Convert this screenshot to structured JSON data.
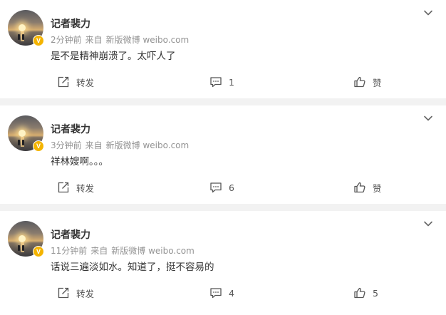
{
  "posts": [
    {
      "username": "记者裴力",
      "time": "2分钟前",
      "source_prefix": "来自",
      "source": "新版微博 weibo.com",
      "content": "是不是精神崩溃了。太吓人了",
      "repost_label": "转发",
      "comment_count": "1",
      "like_label": "赞"
    },
    {
      "username": "记者裴力",
      "time": "3分钟前",
      "source_prefix": "来自",
      "source": "新版微博 weibo.com",
      "content": "祥林嫂啊。。。",
      "repost_label": "转发",
      "comment_count": "6",
      "like_label": "赞"
    },
    {
      "username": "记者裴力",
      "time": "11分钟前",
      "source_prefix": "来自",
      "source": "新版微博 weibo.com",
      "content": "话说三遍淡如水。知道了，挺不容易的",
      "repost_label": "转发",
      "comment_count": "4",
      "like_label": "5"
    }
  ],
  "verified_badge": "V",
  "icons": {
    "menu": "chevron-down-icon",
    "repost": "share-icon",
    "comment": "comment-icon",
    "like": "thumbs-up-icon"
  },
  "colors": {
    "badge": "#f4b400",
    "separator": "#f2f2f2",
    "meta_text": "#939393",
    "main_text": "#333333"
  }
}
